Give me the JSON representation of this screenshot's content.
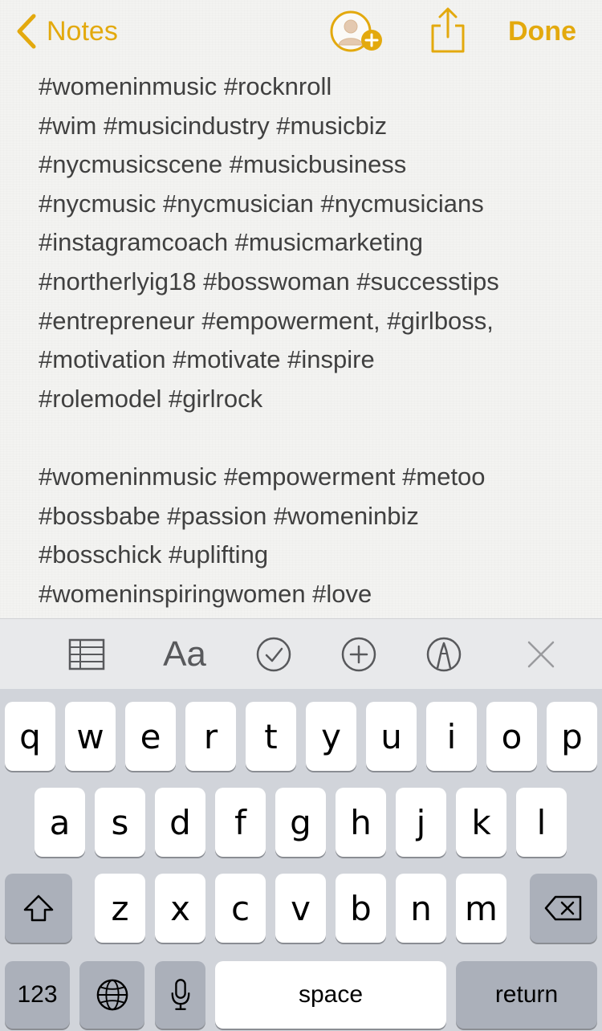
{
  "nav": {
    "back_label": "Notes",
    "done_label": "Done",
    "accent_color": "#e3a90d"
  },
  "note": {
    "lines": [
      "#womeninmusic #rocknroll",
      "#wim #musicindustry #musicbiz",
      "#nycmusicscene #musicbusiness",
      "#nycmusic #nycmusician #nycmusicians",
      "#instagramcoach #musicmarketing",
      "#northerlyig18 #bosswoman #successtips",
      "#entrepreneur #empowerment, #girlboss,",
      "#motivation #motivate #inspire",
      "#rolemodel #girlrock",
      "",
      "#womeninmusic #empowerment #metoo",
      "#bossbabe #passion #womeninbiz",
      "#bosschick #uplifting",
      "#womeninspiringwomen #love"
    ]
  },
  "toolbar": {
    "icons": [
      "table-icon",
      "text-format-icon",
      "checklist-icon",
      "insert-icon",
      "markup-icon",
      "close-icon"
    ],
    "format_label": "Aa"
  },
  "keyboard": {
    "row1": [
      "q",
      "w",
      "e",
      "r",
      "t",
      "y",
      "u",
      "i",
      "o",
      "p"
    ],
    "row2": [
      "a",
      "s",
      "d",
      "f",
      "g",
      "h",
      "j",
      "k",
      "l"
    ],
    "row3": [
      "z",
      "x",
      "c",
      "v",
      "b",
      "n",
      "m"
    ],
    "numbers_label": "123",
    "space_label": "space",
    "return_label": "return"
  }
}
